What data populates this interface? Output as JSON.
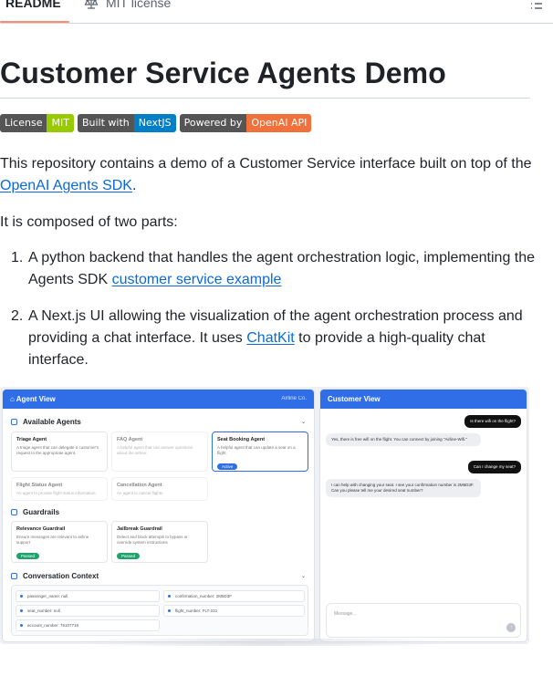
{
  "tabs": {
    "readme": "README",
    "license": "MIT license"
  },
  "title": "Customer Service Agents Demo",
  "badges": [
    {
      "left": "License",
      "right": "MIT",
      "color": "#97ca00"
    },
    {
      "left": "Built with",
      "right": "NextJS",
      "color": "#007ec6"
    },
    {
      "left": "Powered by",
      "right": "OpenAI API",
      "color": "#f0713c"
    }
  ],
  "intro": {
    "text_before": "This repository contains a demo of a Customer Service interface built on top of the ",
    "link": "OpenAI Agents SDK",
    "text_after": "."
  },
  "composed": "It is composed of two parts:",
  "list": {
    "item1_text": "A python backend that handles the agent orchestration logic, implementing the Agents SDK ",
    "item1_link": "customer service example",
    "item2_before": "A Next.js UI allowing the visualization of the agent orchestration process and providing a chat interface. It uses ",
    "item2_link": "ChatKit",
    "item2_after": " to provide a high-quality chat interface."
  },
  "screenshot": {
    "agent_view": "Agent View",
    "agent_view_sub": "Airline Co.",
    "available_agents": "Available Agents",
    "agents": [
      {
        "name": "Triage Agent",
        "desc": "A triage agent that can delegate a customer's request to the appropriate agent."
      },
      {
        "name": "FAQ Agent",
        "desc": "A helpful agent that can answer questions about the airline."
      },
      {
        "name": "Seat Booking Agent",
        "desc": "A helpful agent that can update a seat on a flight.",
        "badge": "Active"
      },
      {
        "name": "Flight Status Agent",
        "desc": "An agent to provide flight status information."
      },
      {
        "name": "Cancellation Agent",
        "desc": "An agent to cancel flights."
      }
    ],
    "guardrails": "Guardrails",
    "guards": [
      {
        "name": "Relevance Guardrail",
        "desc": "Ensure messages are relevant to airline support",
        "badge": "Passed"
      },
      {
        "name": "Jailbreak Guardrail",
        "desc": "Detect and block attempts to bypass or override system instructions",
        "badge": "Passed"
      }
    ],
    "conversation_context": "Conversation Context",
    "context": {
      "passenger": "passenger_name: null",
      "confirmation": "confirmation_number: 2M5D3F",
      "seat": "seat_number: null",
      "flight": "flight_number: FLT-231",
      "account": "account_number: 75107718"
    },
    "customer_view": "Customer View",
    "messages": [
      {
        "role": "user",
        "text": "Is there wifi on the flight?"
      },
      {
        "role": "bot",
        "text": "Yes, there is free wifi on the flight. You can connect by joining \"Airline-Wifi.\""
      },
      {
        "role": "user",
        "text": "Can I change my seat?"
      },
      {
        "role": "bot",
        "text": "I can help with changing your seat. I see your confirmation number is 2M5D3F. Can you please tell me your desired seat number?"
      }
    ],
    "input_placeholder": "Message..."
  }
}
